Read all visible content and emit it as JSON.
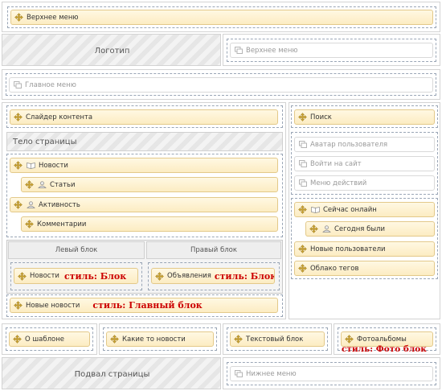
{
  "header_zone": {
    "top_menu": "Верхнее меню"
  },
  "logo_zone": {
    "logo": "Логотип",
    "top_menu": "Верхнее меню"
  },
  "main_menu_zone": {
    "main_menu": "Главное меню"
  },
  "content": {
    "slider": "Слайдер контента",
    "page_body": "Тело страницы",
    "modules": [
      "Новости",
      "Статьи",
      "Активность",
      "Комментарии"
    ],
    "left_block": {
      "title": "Левый блок",
      "module": "Новости",
      "style": "стиль: Блок"
    },
    "right_block": {
      "title": "Правый блок",
      "module": "Объявления",
      "style": "стиль: Блок"
    },
    "latest_news": {
      "module": "Новые новости",
      "style": "стиль: Главный блок"
    }
  },
  "sidebar": {
    "search": "Поиск",
    "avatar": "Аватар пользователя",
    "login": "Войти на сайт",
    "actions_menu": "Меню действий",
    "online_now": "Сейчас онлайн",
    "today_were": "Сегодня были",
    "new_users": "Новые пользователи",
    "tag_cloud": "Облако тегов"
  },
  "bottom_row": {
    "about_template": "О шаблоне",
    "some_news": "Какие то новости",
    "text_block": "Текстовый блок",
    "photo_albums": "Фотоальбомы",
    "photo_style": "стиль: Фото блок"
  },
  "footer": {
    "page_footer": "Подвал страницы",
    "bottom_menu": "Нижнее меню"
  },
  "colors": {
    "module_bg": "#fcecc2",
    "module_border": "#e3c98a",
    "style_text": "#cc0000",
    "dash": "#9aa6b6"
  }
}
